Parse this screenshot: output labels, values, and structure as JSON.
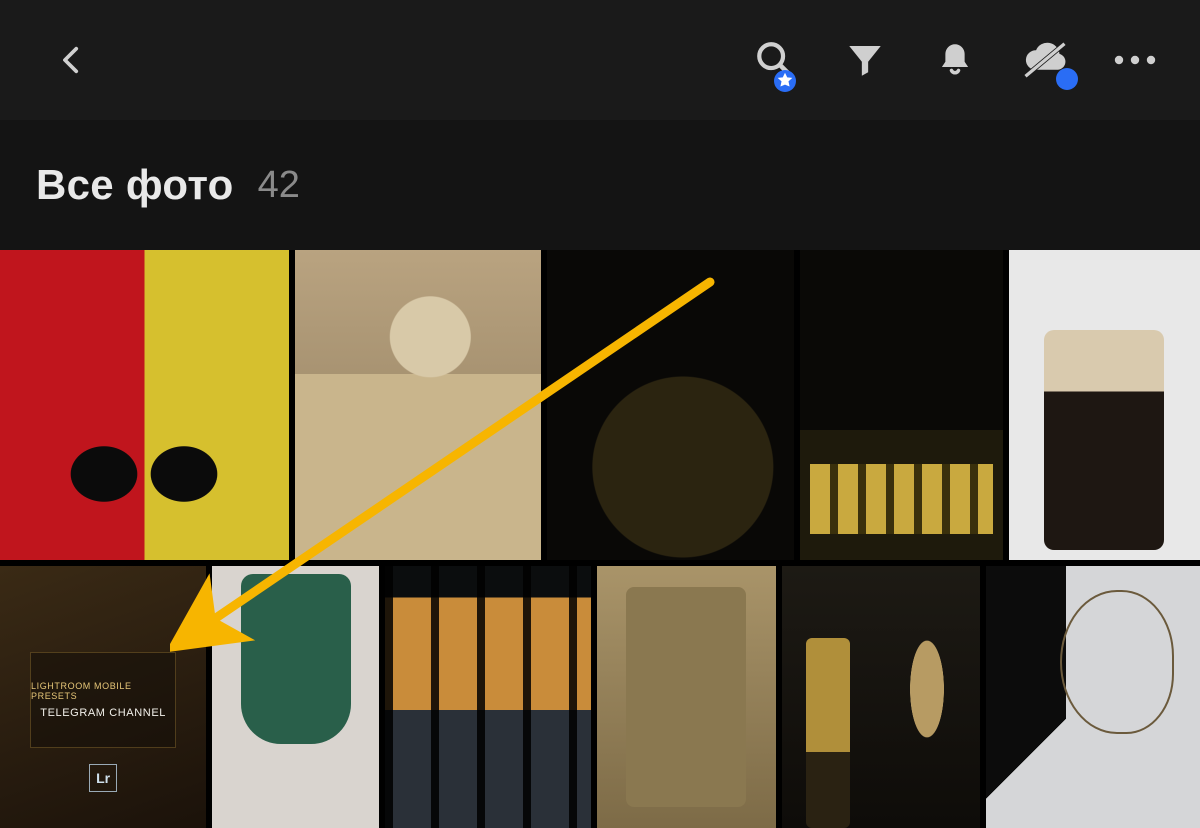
{
  "header": {
    "icons": {
      "back": "back-icon",
      "search": "search-icon",
      "filter": "filter-icon",
      "notifications": "bell-icon",
      "cloud": "cloud-off-icon",
      "more": "more-icon"
    }
  },
  "title": {
    "text": "Все фото",
    "count": "42"
  },
  "gallery": {
    "row1": [
      {
        "name": "photo-heels",
        "alt": "red-yellow-heels"
      },
      {
        "name": "photo-selfie",
        "alt": "mirror-selfie-beige-coat"
      },
      {
        "name": "photo-night-arch",
        "alt": "night-arch"
      },
      {
        "name": "photo-night-building",
        "alt": "night-building-windows"
      },
      {
        "name": "photo-boots",
        "alt": "legs-black-boots"
      }
    ],
    "row2": [
      {
        "name": "photo-lr-preset",
        "alt": "lightroom-preset-card"
      },
      {
        "name": "photo-green-sweater",
        "alt": "green-sweater-pose"
      },
      {
        "name": "photo-airport-sunset",
        "alt": "airport-window-sunset"
      },
      {
        "name": "photo-beige-coat-back",
        "alt": "beige-coat-back"
      },
      {
        "name": "photo-pampas",
        "alt": "pampas-interior"
      },
      {
        "name": "photo-studio",
        "alt": "studio-softbox"
      }
    ]
  },
  "lr_card": {
    "line1": "LIGHTROOM MOBILE PRESETS",
    "line2": "TELEGRAM CHANNEL",
    "logo": "Lr"
  },
  "annotation": {
    "arrow_color": "#f7b500"
  }
}
